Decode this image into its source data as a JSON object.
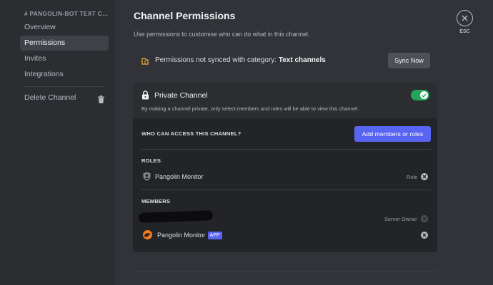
{
  "sidebar": {
    "header": "# PANGOLIN-BOT TEXT CH...",
    "items": [
      {
        "label": "Overview"
      },
      {
        "label": "Permissions"
      },
      {
        "label": "Invites"
      },
      {
        "label": "Integrations"
      }
    ],
    "delete_label": "Delete Channel"
  },
  "main": {
    "title": "Channel Permissions",
    "description": "Use permissions to customise who can do what in this channel.",
    "sync": {
      "text_prefix": "Permissions not synced with category: ",
      "category": "Text channels",
      "button_label": "Sync Now"
    },
    "private": {
      "title": "Private Channel",
      "description": "By making a channel private, only select members and roles will be able to view this channel.",
      "enabled": true
    },
    "access": {
      "label": "WHO CAN ACCESS THIS CHANNEL?",
      "add_button": "Add members or roles"
    },
    "roles": {
      "label": "ROLES",
      "items": [
        {
          "name": "Pangolin Monitor",
          "meta": "Role"
        }
      ]
    },
    "members": {
      "label": "MEMBERS",
      "items": [
        {
          "name": "",
          "meta": "Server Owner"
        },
        {
          "name": "Pangolin Monitor",
          "badge": "APP",
          "meta": ""
        }
      ]
    }
  },
  "close": {
    "label": "ESC"
  },
  "colors": {
    "accent": "#5865f2",
    "toggle_on": "#23a55a",
    "sidebar_bg": "#2b2d31",
    "main_bg": "#313338",
    "avatar_orange": "#f47b20"
  }
}
